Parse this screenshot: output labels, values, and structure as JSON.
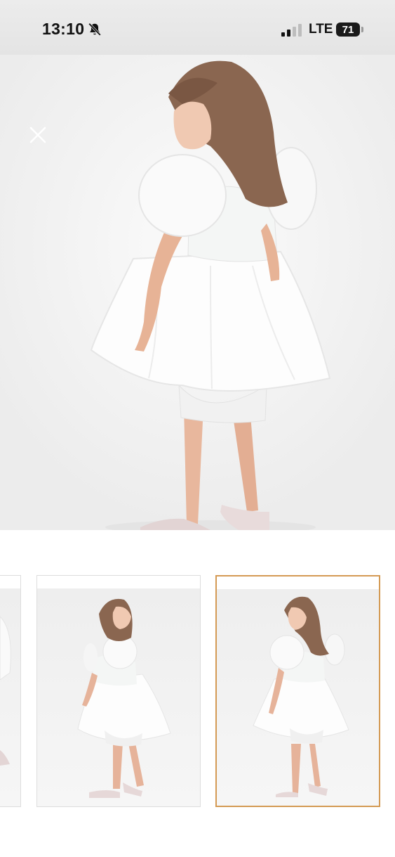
{
  "status_bar": {
    "time": "13:10",
    "mute_icon": "bell-slash-icon",
    "signal_icon": "cellular-signal-icon",
    "network": "LTE",
    "battery_level": "71"
  },
  "viewer": {
    "close_icon": "close-icon",
    "main_image_subject": "girl-white-puff-sleeve-dress-back-view",
    "thumbnails": [
      {
        "id": "1",
        "selected": false
      },
      {
        "id": "2",
        "selected": false
      },
      {
        "id": "3",
        "selected": true
      }
    ],
    "selected_border_color": "#d49a54"
  }
}
